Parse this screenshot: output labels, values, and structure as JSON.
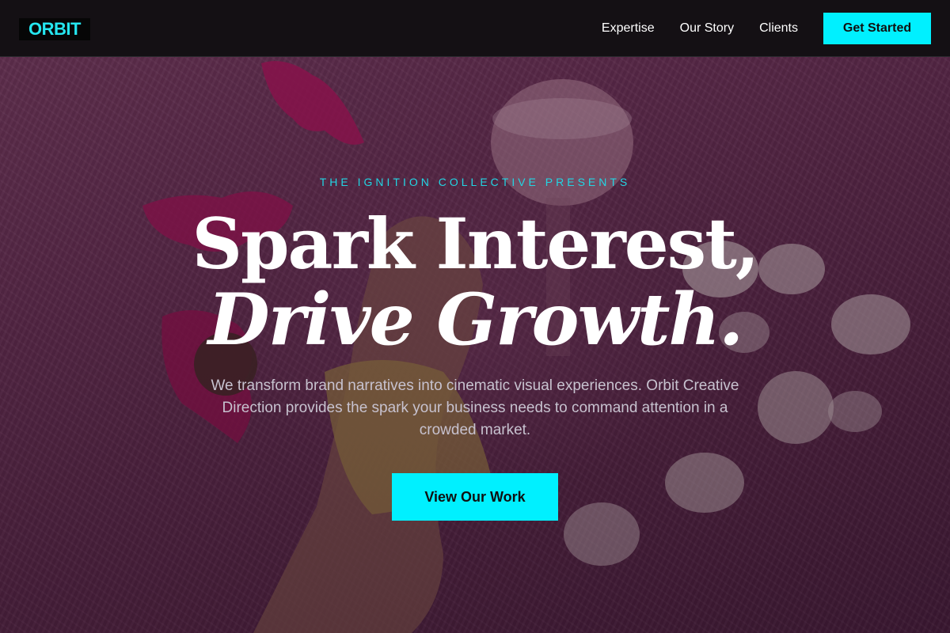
{
  "header": {
    "logo": "ORBIT",
    "nav": [
      "Expertise",
      "Our Story",
      "Clients"
    ],
    "cta": "Get Started"
  },
  "hero": {
    "eyebrow": "THE IGNITION COLLECTIVE PRESENTS",
    "headline_line1": "Spark Interest,",
    "headline_line2": "Drive Growth.",
    "subtext": "We transform brand narratives into cinematic visual experiences. Orbit Creative Direction provides the spark your business needs to command attention in a crowded market.",
    "cta": "View Our Work",
    "background_image": "pink-fur-hand-jewelry-photo"
  },
  "colors": {
    "accent": "#00f0ff",
    "nav_bg": "#141014",
    "eyebrow": "#22d6e4"
  }
}
